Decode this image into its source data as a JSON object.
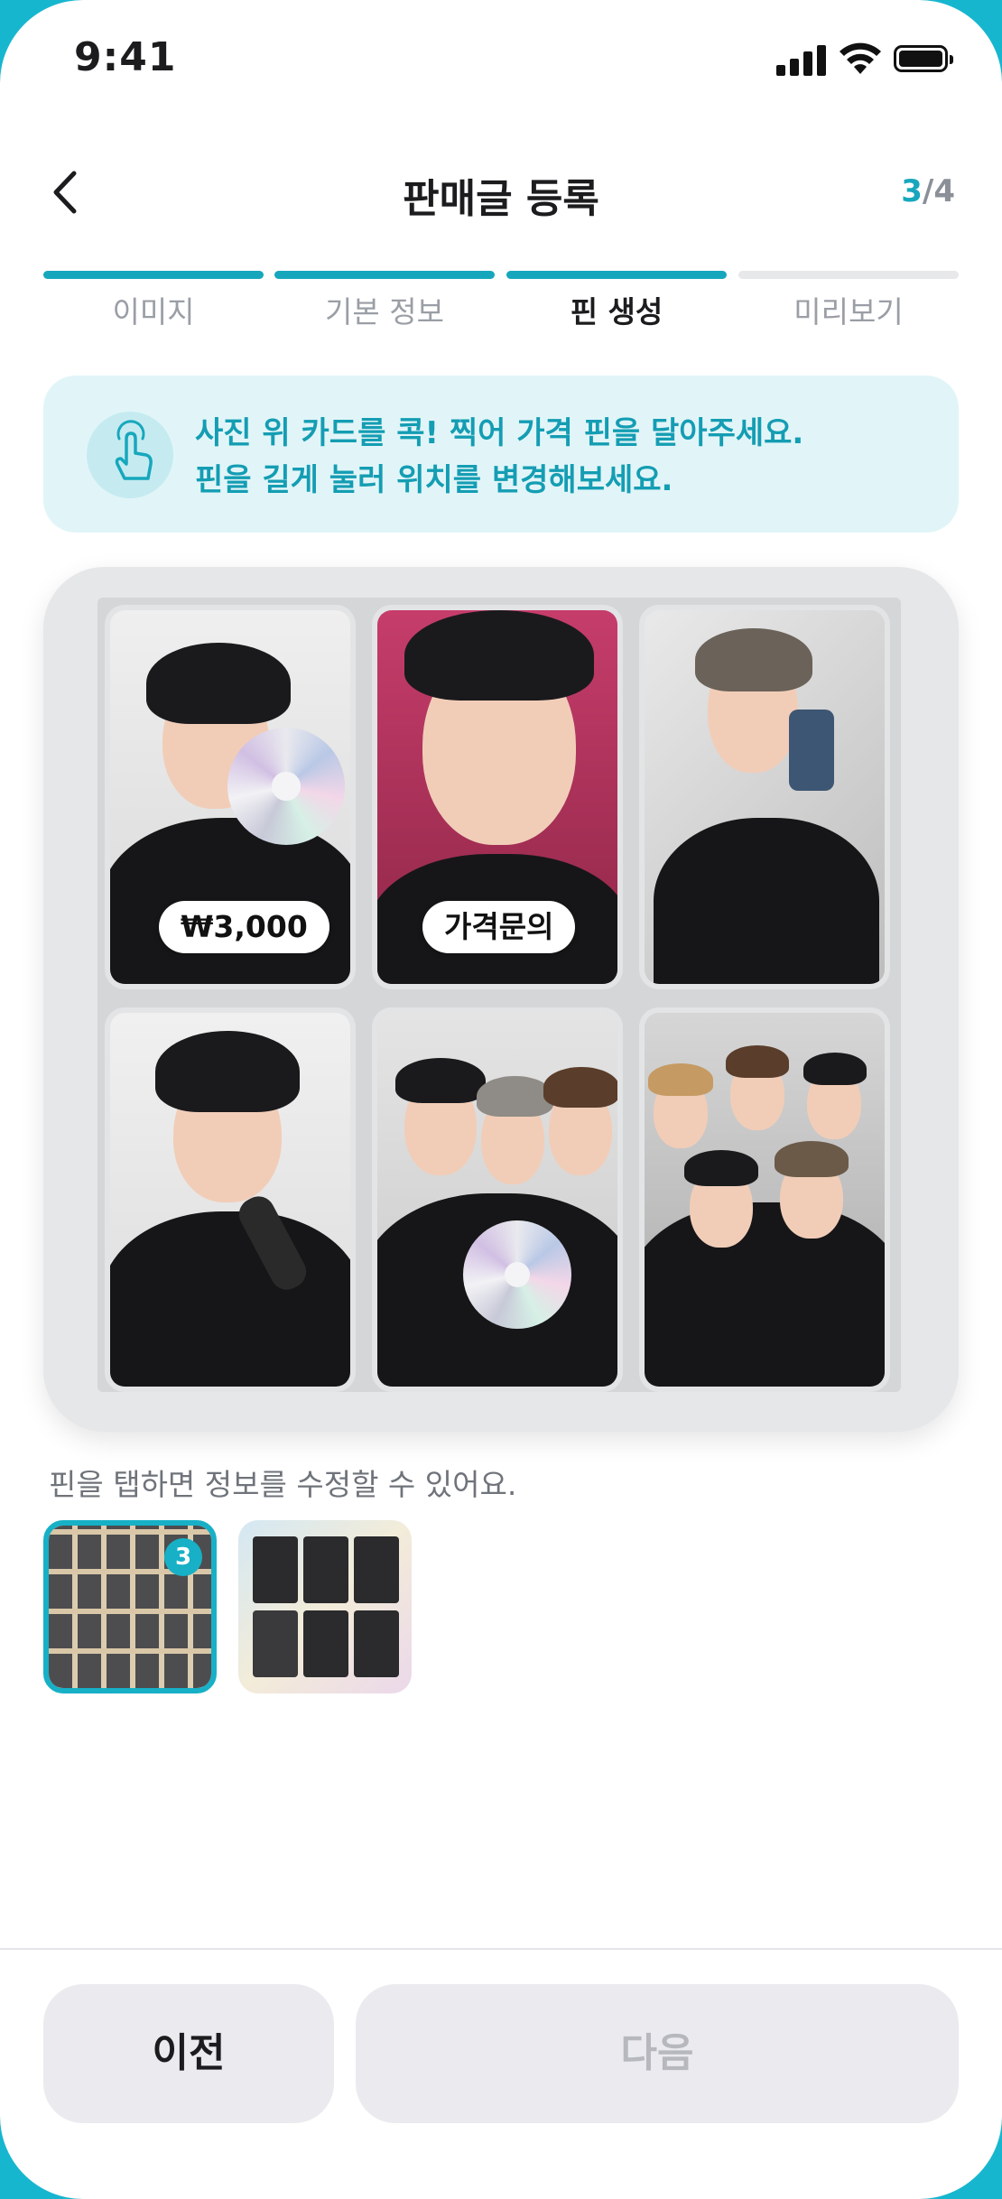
{
  "status_bar": {
    "time": "9:41"
  },
  "header": {
    "title": "판매글 등록",
    "step_current": "3",
    "step_sep": "/",
    "step_total": "4"
  },
  "stepper": {
    "steps": [
      {
        "label": "이미지",
        "state": "done"
      },
      {
        "label": "기본 정보",
        "state": "done"
      },
      {
        "label": "핀 생성",
        "state": "current"
      },
      {
        "label": "미리보기",
        "state": "todo"
      }
    ]
  },
  "banner": {
    "line1": "사진 위 카드를 콕! 찍어 가격 핀을 달아주세요.",
    "line2": "핀을 길게 눌러 위치를 변경해보세요.",
    "icon": "tap-hand-icon"
  },
  "board": {
    "pins": [
      {
        "label": "₩3,000",
        "card": 1
      },
      {
        "label": "가격문의",
        "card": 2
      }
    ]
  },
  "hint": "핀을 탭하면 정보를 수정할 수 있어요.",
  "thumbnails": [
    {
      "selected": true,
      "badge": "3"
    },
    {
      "selected": false
    }
  ],
  "footer": {
    "prev_label": "이전",
    "next_label": "다음",
    "next_enabled": false
  },
  "colors": {
    "accent": "#17a7bd",
    "banner_bg": "#e1f5f8",
    "frame": "#17b6cf"
  }
}
